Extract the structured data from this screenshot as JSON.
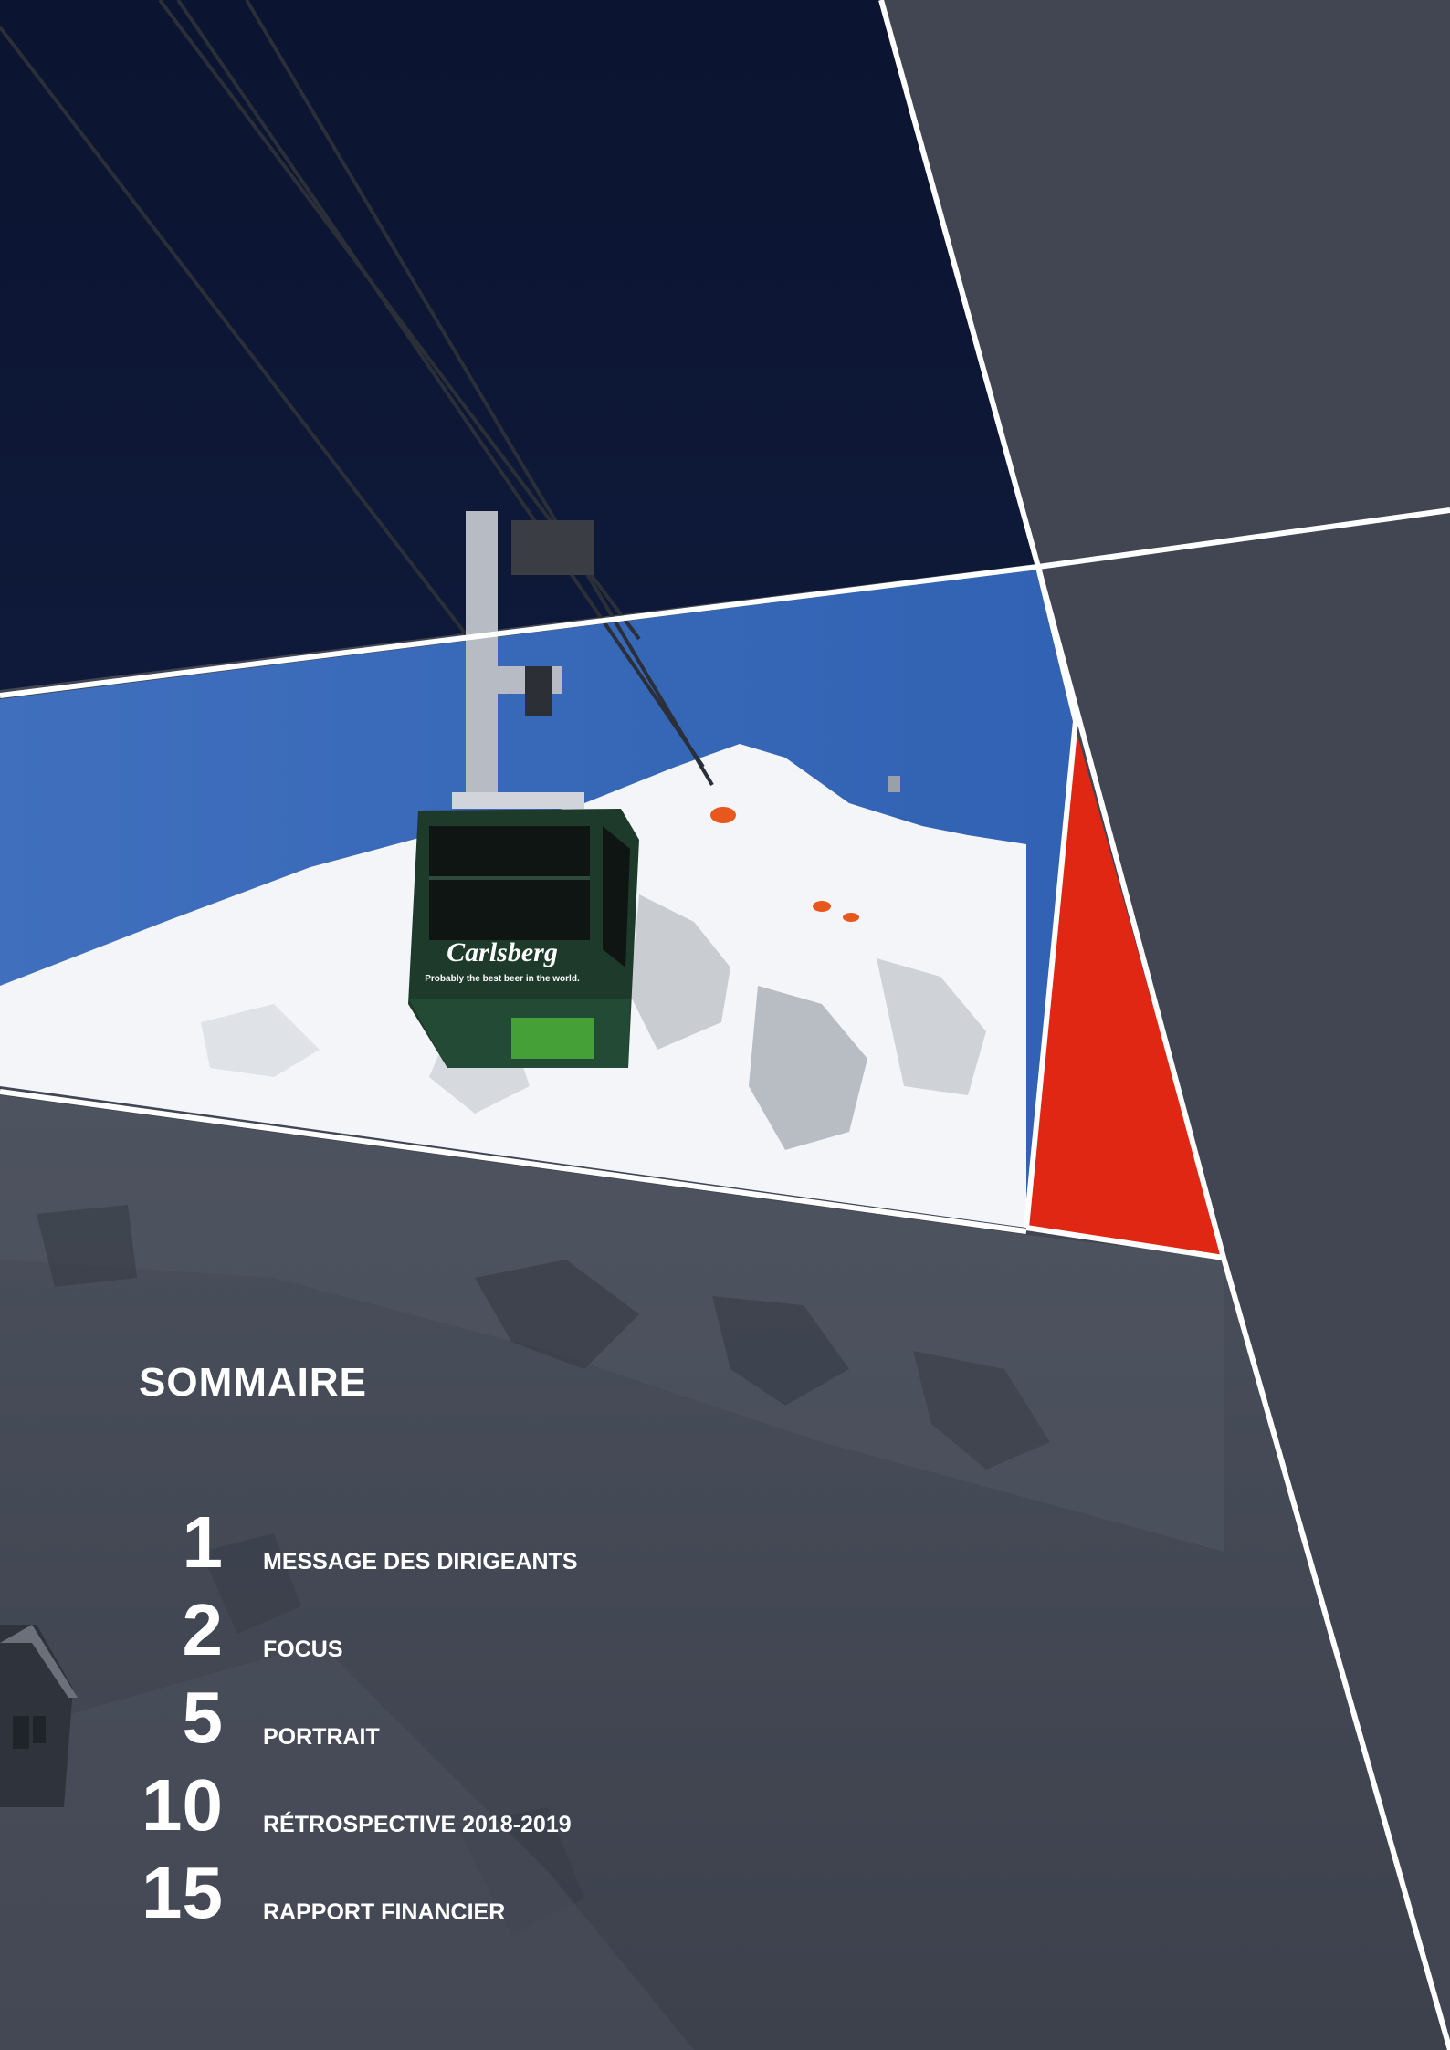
{
  "toc": {
    "title": "SOMMAIRE",
    "entries": [
      {
        "page": "1",
        "label": "MESSAGE DES DIRIGEANTS"
      },
      {
        "page": "2",
        "label": "FOCUS"
      },
      {
        "page": "5",
        "label": "PORTRAIT"
      },
      {
        "page": "10",
        "label": "RÉTROSPECTIVE 2018-2019"
      },
      {
        "page": "15",
        "label": "RAPPORT FINANCIER"
      }
    ]
  },
  "photo": {
    "gondola_brand": "Carlsberg",
    "gondola_slogan": "Probably the best beer in the world."
  },
  "colors": {
    "navy": "#0b1330",
    "slate": "#414652",
    "sky": "#3b6db8",
    "accent_red": "#e02714",
    "gondola_green": "#1e3a2c"
  }
}
